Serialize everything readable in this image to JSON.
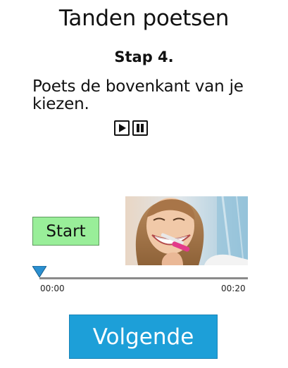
{
  "page": {
    "title": "Tanden poetsen",
    "step_label": "Stap 4.",
    "instruction": "Poets de bovenkant van je kiezen."
  },
  "media_controls": {
    "play_icon": "play-icon",
    "pause_icon": "pause-icon"
  },
  "start_button": {
    "label": "Start",
    "color": "#99ee99"
  },
  "photo": {
    "subject": "woman-brushing-teeth"
  },
  "timeline": {
    "start_time": "00:00",
    "end_time": "00:20",
    "progress": 0,
    "marker_color": "#2a8fd0"
  },
  "next_button": {
    "label": "Volgende",
    "color": "#1d9fd8"
  }
}
